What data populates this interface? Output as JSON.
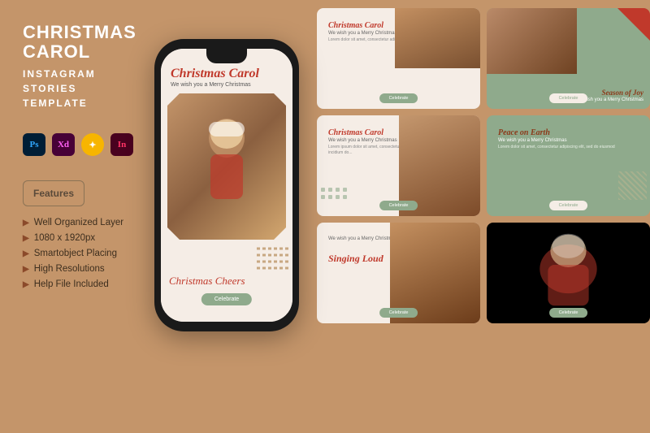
{
  "page": {
    "bg_color": "#c4956a"
  },
  "left": {
    "main_title": "CHRISTMAS CAROL",
    "sub_title_line1": "INSTAGRAM",
    "sub_title_line2": "STORIES",
    "sub_title_line3": "TEMPLATE",
    "features_label": "Features",
    "features": [
      "Well Organized Layer",
      "1080 x 1920px",
      "Smartobject Placing",
      "High Resolutions",
      "Help File Included"
    ]
  },
  "phone": {
    "script_title": "Christmas Carol",
    "subtitle": "We wish you a Merry Christmas",
    "bottom_text": "Christmas Cheers",
    "celebrate_btn": "Celebrate"
  },
  "cards": [
    {
      "id": "card-1",
      "title": "Christmas Carol",
      "subtitle": "We wish you a Merry Christmas",
      "body": "Lorem dolor sit amet, consectetur adipiscing elit, sed do eiusmod tempor",
      "btn": "Celebrate",
      "has_image": true,
      "position": "top-right"
    },
    {
      "id": "card-2",
      "title": "Season of Joy",
      "subtitle": "We wish you a Merry Christmas",
      "btn": "Celebrate",
      "has_image": true,
      "green": true
    },
    {
      "id": "card-3",
      "title": "Christmas Carol",
      "subtitle": "We wish you a Merry Christmas",
      "body": "Lorem ipsum dolor sit amet, consectetur adipiscing elit, sed do eiusmod incidium do...",
      "btn": "Celebrate",
      "has_image": true
    },
    {
      "id": "card-4",
      "title": "Peace on Earth",
      "subtitle": "We wish you a Merry Christmas",
      "body": "Lorem dolor sit amet, consectetur adipiscing elit, sed do eiusmod",
      "btn": "Celebrate",
      "has_image": true,
      "green": true
    },
    {
      "id": "card-5",
      "subtitle": "We wish you a Merry Christmas",
      "title": "Singing Loud",
      "btn": "Celebrate",
      "has_image": false
    },
    {
      "id": "card-6",
      "title": "",
      "btn": "Celebrate",
      "has_image": true
    }
  ]
}
